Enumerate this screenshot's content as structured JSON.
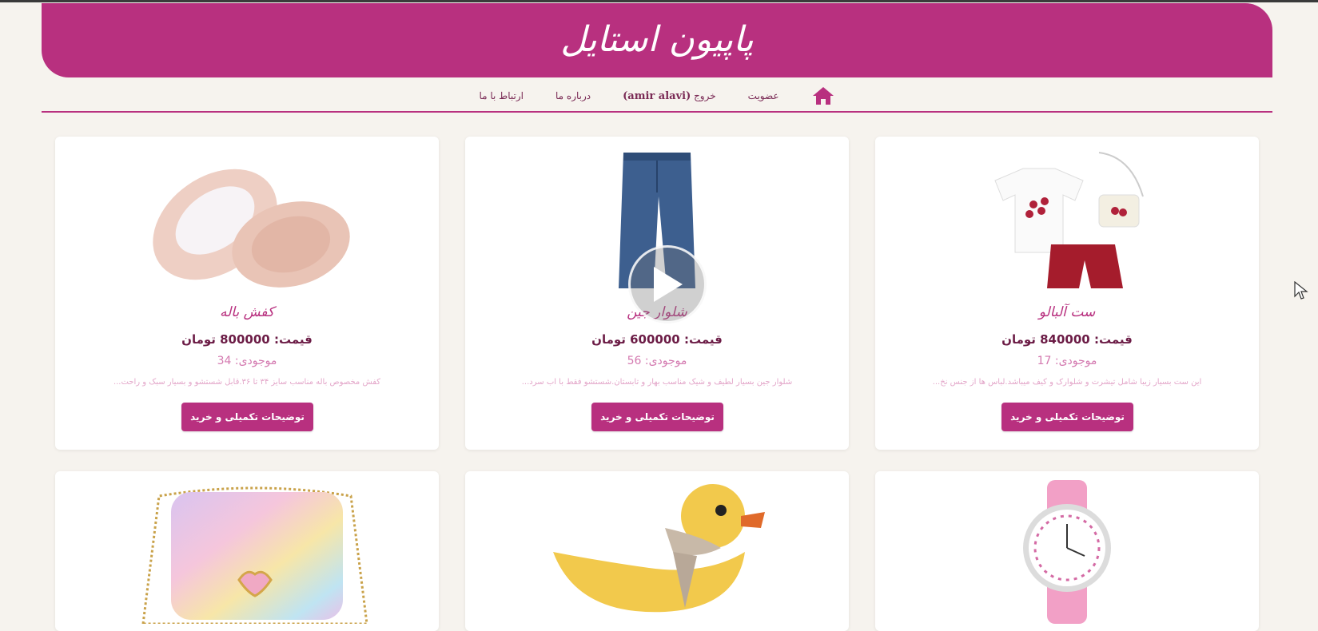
{
  "site": {
    "logo": "پاپیون استایل"
  },
  "nav": {
    "home_icon": "home-icon",
    "items": [
      {
        "label": "عضویت"
      },
      {
        "label_prefix": "خروج",
        "user": "(amir alavi)"
      },
      {
        "label": "درباره ما"
      },
      {
        "label": "ارتباط با ما"
      }
    ]
  },
  "products": [
    {
      "title": "ست آلبالو",
      "price": "قیمت: 840000 تومان",
      "stock": "موجودی: 17",
      "desc": "این ست بسیار زیبا شامل تیشرت و شلوارک و کیف میباشد.لباس ها از جنس نخ...",
      "button": "توضیحات تکمیلی و خرید",
      "image": "cherry-outfit-image"
    },
    {
      "title": "شلوار جین",
      "price": "قیمت: 600000 تومان",
      "stock": "موجودی: 56",
      "desc": "شلوار جین بسیار لطیف و شیک مناسب بهار و تابستان.شستشو فقط با آب سرد...",
      "button": "توضیحات تکمیلی و خرید",
      "image": "jeans-image"
    },
    {
      "title": "کفش باله",
      "price": "قیمت: 800000 تومان",
      "stock": "موجودی: 34",
      "desc": "کفش مخصوص باله مناسب سایز ۳۴ تا ۳۶.قابل شستشو و بسیار سبک و راحت...",
      "button": "توضیحات تکمیلی و خرید",
      "image": "ballet-shoes-image"
    },
    {
      "image": "pink-watch-image"
    },
    {
      "image": "crochet-duck-bag-image"
    },
    {
      "image": "glitter-handbag-image"
    }
  ],
  "overlay": {
    "play_icon": "play-icon"
  },
  "colors": {
    "brand": "#b8307f",
    "background": "#f6f3ee",
    "price": "#6b1b45",
    "stock": "#d47ab0"
  }
}
